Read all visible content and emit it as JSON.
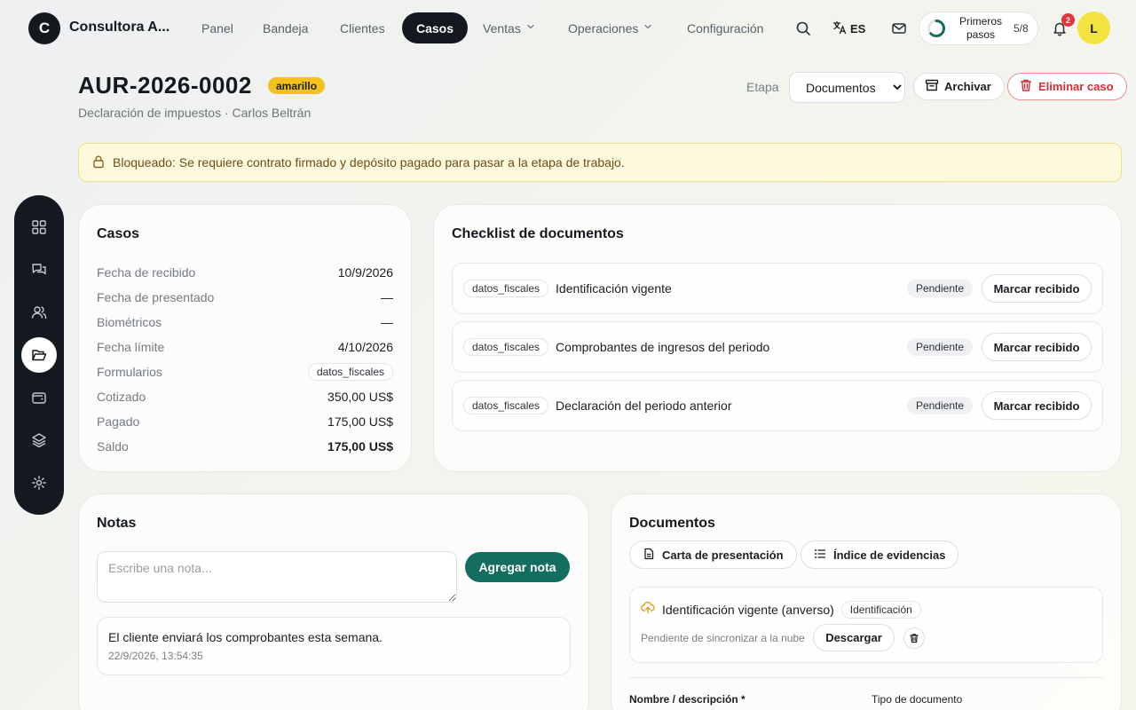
{
  "brand": {
    "initial": "C",
    "name": "Consultora A..."
  },
  "nav": {
    "items": [
      {
        "label": "Panel"
      },
      {
        "label": "Bandeja"
      },
      {
        "label": "Clientes"
      },
      {
        "label": "Casos"
      },
      {
        "label": "Ventas"
      },
      {
        "label": "Operaciones"
      },
      {
        "label": "Configuración"
      }
    ],
    "active": "Casos",
    "lang": "ES",
    "onboarding": {
      "line1": "Primeros",
      "line2": "pasos",
      "count": "5/8",
      "progress": 0.625
    },
    "notifications": "2",
    "avatar": "L"
  },
  "case": {
    "id": "AUR-2026-0002",
    "badge": "amarillo",
    "subtitle": "Declaración de impuestos · Carlos Beltrán",
    "stage_label": "Etapa",
    "stage_value": "Documentos",
    "archive_label": "Archivar",
    "delete_label": "Eliminar caso"
  },
  "alert": {
    "text": "Bloqueado: Se requiere contrato firmado y depósito pagado para pasar a la etapa de trabajo."
  },
  "summary": {
    "title": "Casos",
    "rows": [
      {
        "label": "Fecha de recibido",
        "value": "10/9/2026"
      },
      {
        "label": "Fecha de presentado",
        "value": "—"
      },
      {
        "label": "Biométricos",
        "value": "—"
      },
      {
        "label": "Fecha límite",
        "value": "4/10/2026"
      },
      {
        "label": "Formularios",
        "value": "datos_fiscales"
      },
      {
        "label": "Cotizado",
        "value": "350,00 US$"
      },
      {
        "label": "Pagado",
        "value": "175,00 US$"
      },
      {
        "label": "Saldo",
        "value": "175,00 US$"
      }
    ]
  },
  "checklist": {
    "title": "Checklist de documentos",
    "items": [
      {
        "tag": "datos_fiscales",
        "name": "Identificación vigente",
        "status": "Pendiente",
        "action": "Marcar recibido"
      },
      {
        "tag": "datos_fiscales",
        "name": "Comprobantes de ingresos del periodo",
        "status": "Pendiente",
        "action": "Marcar recibido"
      },
      {
        "tag": "datos_fiscales",
        "name": "Declaración del periodo anterior",
        "status": "Pendiente",
        "action": "Marcar recibido"
      }
    ]
  },
  "notes": {
    "title": "Notas",
    "placeholder": "Escribe una nota...",
    "add_label": "Agregar nota",
    "items": [
      {
        "text": "El cliente enviará los comprobantes esta semana.",
        "time": "22/9/2026, 13:54:35"
      }
    ]
  },
  "documents": {
    "title": "Documentos",
    "cover_letter": "Carta de presentación",
    "evidence_index": "Índice de evidencias",
    "files": [
      {
        "name": "Identificación vigente (anverso)",
        "type": "Identificación",
        "sync": "Pendiente de sincronizar a la nube",
        "download": "Descargar"
      }
    ],
    "form": {
      "name_label": "Nombre / descripción *",
      "type_label": "Tipo de documento"
    }
  },
  "icons": {
    "rail": [
      "grid-icon",
      "chat-icon",
      "users-icon",
      "folder-icon",
      "wallet-icon",
      "layers-icon",
      "gear-icon"
    ],
    "accent": "#136e60",
    "badge_color": "#f4c21c",
    "danger": "#d92d36"
  }
}
